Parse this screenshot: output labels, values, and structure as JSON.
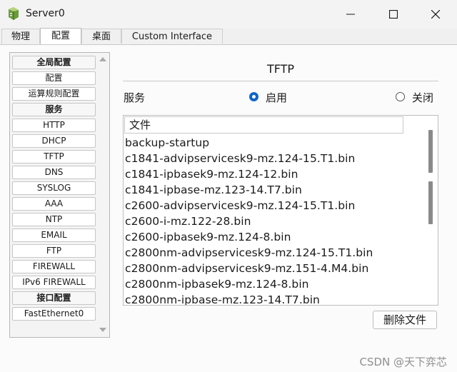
{
  "window": {
    "title": "Server0",
    "icon": "server-app-icon",
    "controls": [
      "minimize-icon",
      "maximize-icon",
      "close-icon"
    ]
  },
  "tabs": [
    {
      "label": "物理",
      "active": false
    },
    {
      "label": "配置",
      "active": true
    },
    {
      "label": "桌面",
      "active": false
    },
    {
      "label": "Custom Interface",
      "active": false
    }
  ],
  "sidebar": {
    "items": [
      {
        "label": "全局配置",
        "header": true
      },
      {
        "label": "配置",
        "header": false
      },
      {
        "label": "运算规则配置",
        "header": false
      },
      {
        "label": "服务",
        "header": true
      },
      {
        "label": "HTTP",
        "header": false
      },
      {
        "label": "DHCP",
        "header": false
      },
      {
        "label": "TFTP",
        "header": false
      },
      {
        "label": "DNS",
        "header": false
      },
      {
        "label": "SYSLOG",
        "header": false
      },
      {
        "label": "AAA",
        "header": false
      },
      {
        "label": "NTP",
        "header": false
      },
      {
        "label": "EMAIL",
        "header": false
      },
      {
        "label": "FTP",
        "header": false
      },
      {
        "label": "FIREWALL",
        "header": false
      },
      {
        "label": "IPv6 FIREWALL",
        "header": false
      },
      {
        "label": "接口配置",
        "header": true
      },
      {
        "label": "FastEthernet0",
        "header": false
      }
    ]
  },
  "main": {
    "title": "TFTP",
    "service_label": "服务",
    "radio_on": {
      "label": "启用",
      "checked": true
    },
    "radio_off": {
      "label": "关闭",
      "checked": false
    },
    "files_header": "文件",
    "files": [
      "backup-startup",
      "c1841-advipservicesk9-mz.124-15.T1.bin",
      "c1841-ipbasek9-mz.124-12.bin",
      "c1841-ipbase-mz.123-14.T7.bin",
      "c2600-advipservicesk9-mz.124-15.T1.bin",
      "c2600-i-mz.122-28.bin",
      "c2600-ipbasek9-mz.124-8.bin",
      "c2800nm-advipservicesk9-mz.124-15.T1.bin",
      "c2800nm-advipservicesk9-mz.151-4.M4.bin",
      "c2800nm-ipbasek9-mz.124-8.bin",
      "c2800nm-ipbase-mz.123-14.T7.bin"
    ],
    "delete_button": "删除文件"
  },
  "watermark": "CSDN @天下弈芯",
  "colors": {
    "accent": "#0f67c6",
    "window_bg": "#f0f0f0",
    "content_bg": "#fbfbfb"
  }
}
